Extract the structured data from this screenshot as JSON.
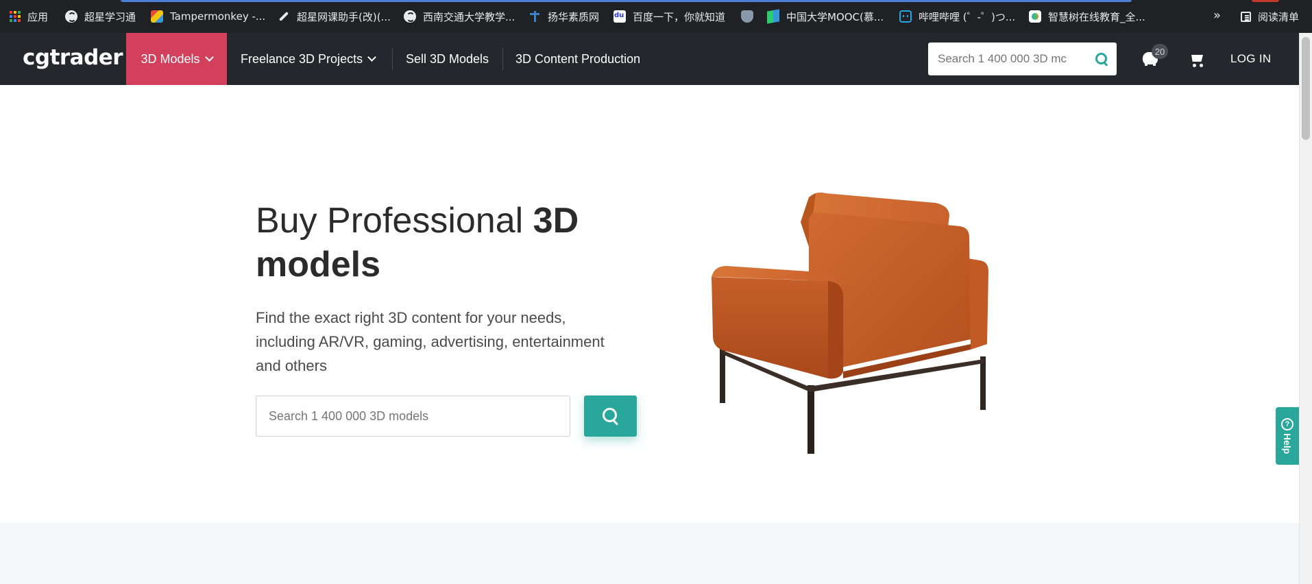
{
  "browser": {
    "bookmarks": [
      {
        "label": "应用",
        "icon": "apps-icon"
      },
      {
        "label": "超星学习通",
        "icon": "globe-icon"
      },
      {
        "label": "Tampermonkey -...",
        "icon": "tampermonkey-icon"
      },
      {
        "label": "超星网课助手(改)(...",
        "icon": "wrench-icon"
      },
      {
        "label": "西南交通大学教学...",
        "icon": "globe-icon"
      },
      {
        "label": "扬华素质网",
        "icon": "tower-icon"
      },
      {
        "label": "百度一下，你就知道",
        "icon": "baidu-icon"
      },
      {
        "label": "",
        "icon": "badge-icon"
      },
      {
        "label": "中国大学MOOC(慕...",
        "icon": "mooc-icon"
      },
      {
        "label": "哔哩哔哩 (゜-゜)つ...",
        "icon": "bilibili-icon"
      },
      {
        "label": "智慧树在线教育_全...",
        "icon": "zhihuishu-icon"
      }
    ],
    "more": "»",
    "reading_list": "阅读清单"
  },
  "nav": {
    "logo": "cgtrader",
    "links": [
      "3D Models",
      "Freelance 3D Projects",
      "Sell 3D Models",
      "3D Content Production"
    ],
    "search_placeholder": "Search 1 400 000 3D mc",
    "piggy_count": "20",
    "login": "LOG IN"
  },
  "hero": {
    "title_light": "Buy Professional ",
    "title_bold_1": "3D",
    "title_bold_2": "models",
    "description": "Find the exact right 3D content for your needs, including AR/VR, gaming, advertising, entertainment and others",
    "search_placeholder": "Search 1 400 000 3D models",
    "image": "orange-armchair"
  },
  "help": {
    "label": "Help"
  },
  "colors": {
    "nav_bg": "#24272b",
    "accent_pink": "#d3405c",
    "accent_teal": "#2aa79b",
    "chair_orange": "#c9602a"
  }
}
